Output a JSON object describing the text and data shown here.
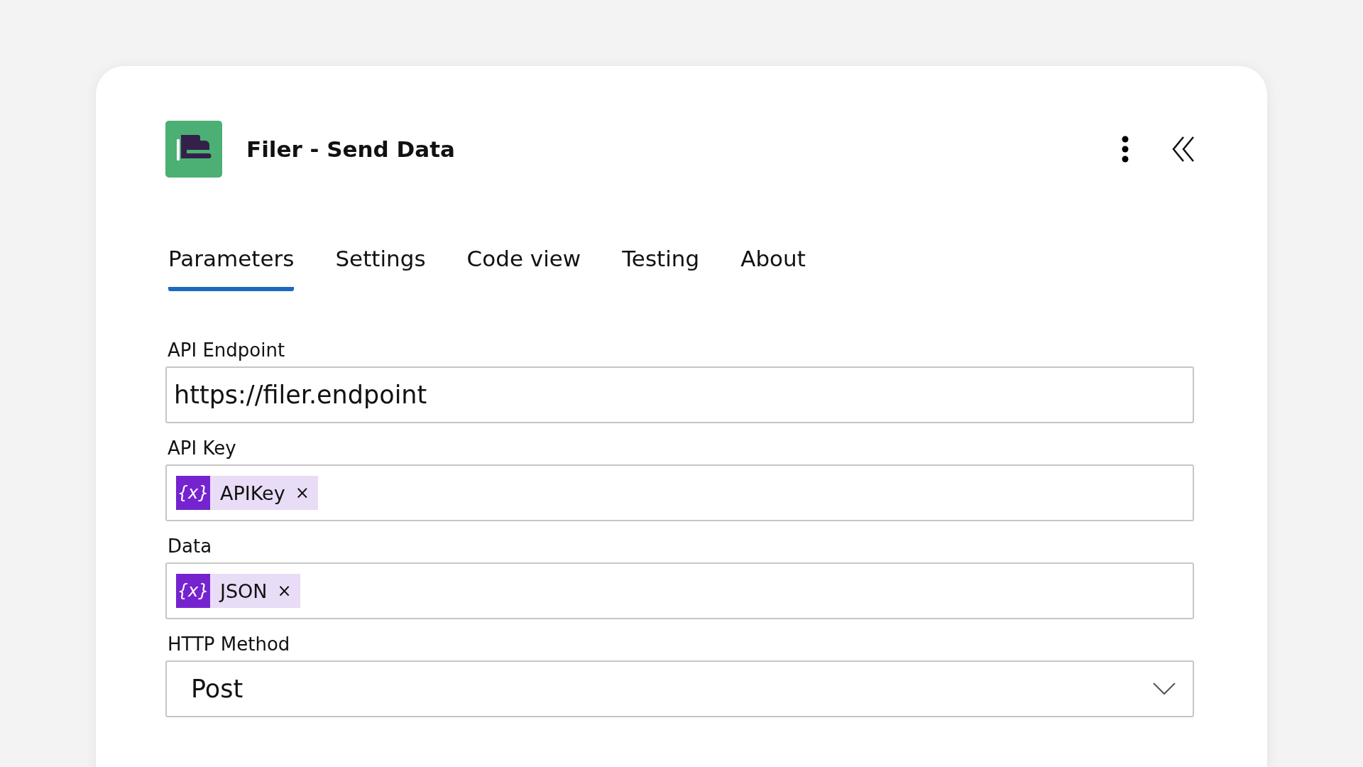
{
  "header": {
    "title": "Filer - Send Data"
  },
  "tabs": [
    {
      "label": "Parameters",
      "selected": true
    },
    {
      "label": "Settings",
      "selected": false
    },
    {
      "label": "Code view",
      "selected": false
    },
    {
      "label": "Testing",
      "selected": false
    },
    {
      "label": "About",
      "selected": false
    }
  ],
  "fields": [
    {
      "kind": "text",
      "label": "API Endpoint",
      "value": "https://filer.endpoint"
    },
    {
      "kind": "token",
      "label": "API Key",
      "token": {
        "icon": "{x}",
        "text": "APIKey",
        "remove": "×"
      }
    },
    {
      "kind": "token",
      "label": "Data",
      "token": {
        "icon": "{x}",
        "text": "JSON",
        "remove": "×"
      }
    },
    {
      "kind": "dropdown",
      "label": "HTTP Method",
      "value": "Post"
    }
  ]
}
